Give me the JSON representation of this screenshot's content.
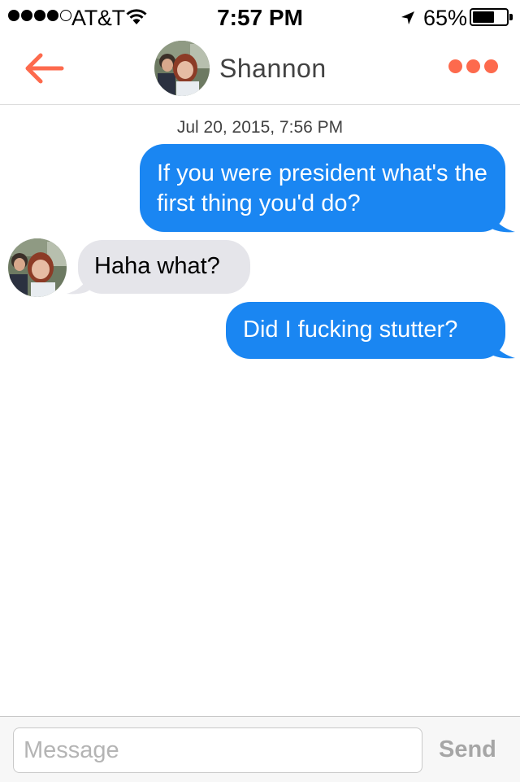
{
  "status_bar": {
    "carrier": "AT&T",
    "signal_bars_filled": 4,
    "signal_bars_total": 5,
    "time": "7:57 PM",
    "battery_percent": "65%",
    "battery_level": 0.65
  },
  "header": {
    "contact_name": "Shannon",
    "back_icon": "back-arrow-icon",
    "more_icon": "more-dots-icon",
    "accent_color": "#fd6a4d"
  },
  "conversation": {
    "timestamp": "Jul 20, 2015, 7:56 PM",
    "messages": [
      {
        "direction": "outgoing",
        "text": "If you were president what's the first thing you'd do?"
      },
      {
        "direction": "incoming",
        "text": "Haha what?"
      },
      {
        "direction": "outgoing",
        "text": "Did I fucking stutter?"
      }
    ],
    "outgoing_color": "#1a86f2",
    "incoming_color": "#e5e5ea"
  },
  "input": {
    "placeholder": "Message",
    "value": "",
    "send_label": "Send"
  }
}
